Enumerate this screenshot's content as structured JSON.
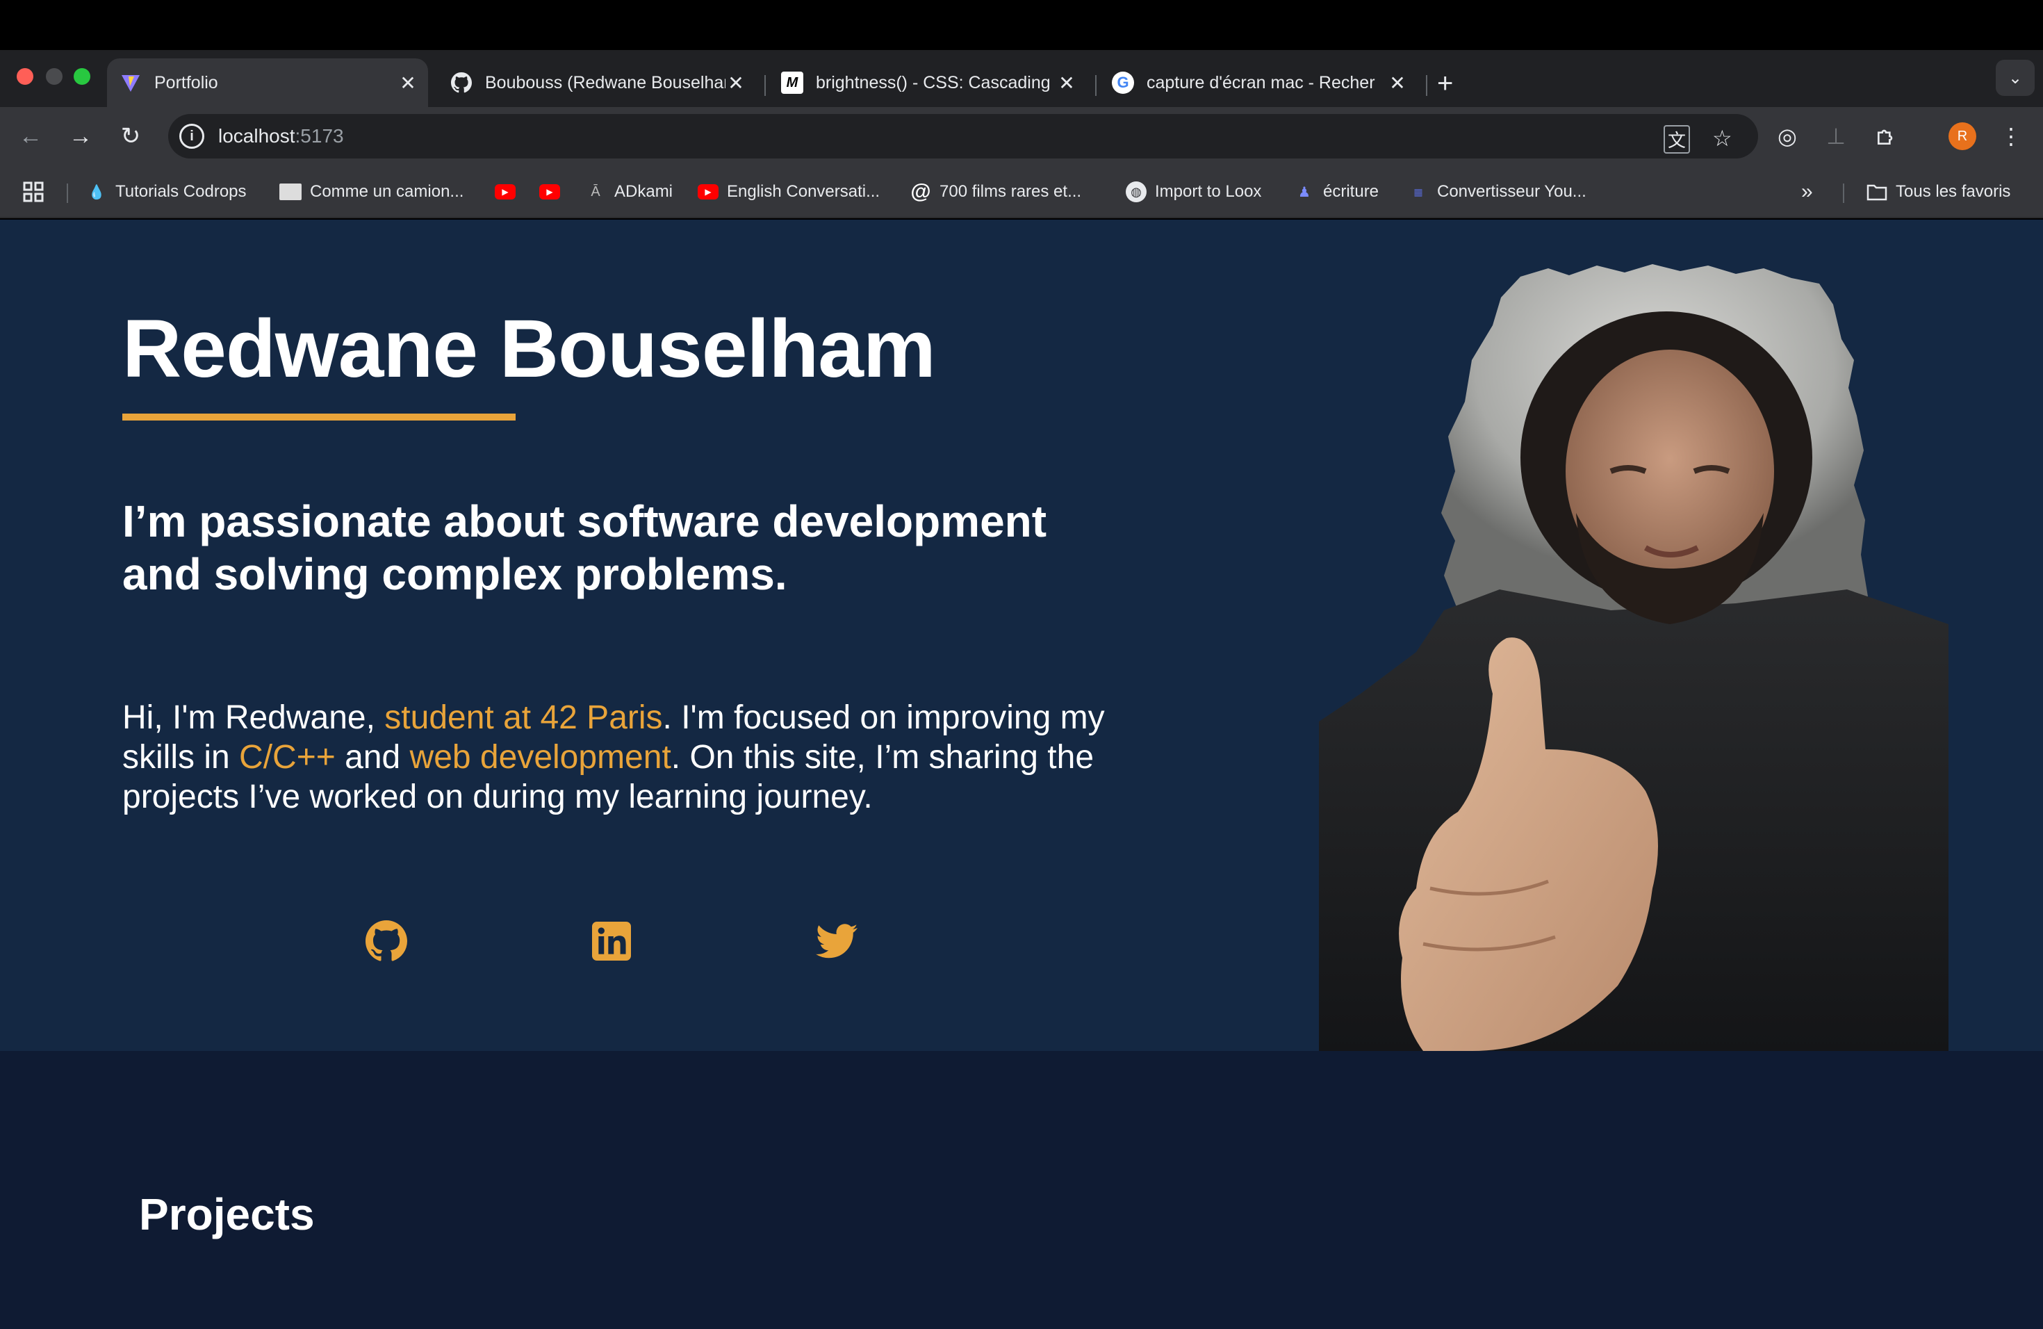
{
  "browser": {
    "tabs": [
      {
        "title": "Portfolio",
        "favicon": "vite-icon",
        "active": true
      },
      {
        "title": "Boubouss (Redwane Bouselham)",
        "favicon": "github-icon",
        "active": false
      },
      {
        "title": "brightness() - CSS: Cascading",
        "favicon": "mdn-icon",
        "active": false
      },
      {
        "title": "capture d'écran mac - Recher",
        "favicon": "google-icon",
        "active": false
      }
    ],
    "address": {
      "host": "localhost",
      "port": ":5173"
    },
    "profile_initial": "R",
    "bookmarks": [
      {
        "label": "Tutorials Codrops",
        "icon": "codrops-icon"
      },
      {
        "label": "Comme un camion...",
        "icon": "camion-icon"
      },
      {
        "label": "",
        "icon": "youtube-icon"
      },
      {
        "label": "",
        "icon": "youtube-icon"
      },
      {
        "label": "ADkami",
        "icon": "adkami-icon"
      },
      {
        "label": "English Conversati...",
        "icon": "youtube-icon"
      },
      {
        "label": "700 films rares et...",
        "icon": "at-icon"
      },
      {
        "label": "Import to Loox",
        "icon": "globe-icon"
      },
      {
        "label": "écriture",
        "icon": "ecriture-icon"
      },
      {
        "label": "Convertisseur You...",
        "icon": "converter-icon"
      }
    ],
    "all_bookmarks_label": "Tous les favoris"
  },
  "hero": {
    "name": "Redwane Bouselham",
    "tagline": "I’m passionate about software development and solving complex problems.",
    "intro": {
      "part1": "Hi, I'm Redwane, ",
      "hl1": "student at 42 Paris",
      "part2": ". I'm focused on improving my skills in ",
      "hl2": "C/C++",
      "part3": " and ",
      "hl3": "web development",
      "part4": ". On this site, I’m sharing the projects I’ve worked on during my learning journey."
    },
    "social": [
      "github-icon",
      "linkedin-icon",
      "twitter-icon"
    ],
    "accent_color": "#e9a43a",
    "background_color": "#142843"
  },
  "projects": {
    "title": "Projects"
  }
}
